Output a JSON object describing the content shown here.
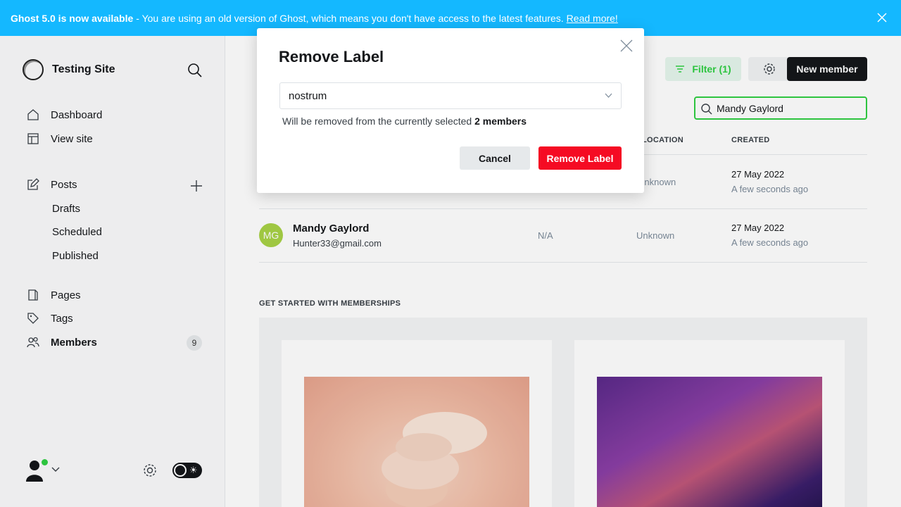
{
  "banner": {
    "title": "Ghost 5.0 is now available",
    "message": "- You are using an old version of Ghost, which means you don't have access to the latest features.",
    "link": "Read more!",
    "color": "#14b8ff"
  },
  "sidebar": {
    "site_title": "Testing Site",
    "nav": {
      "dashboard": "Dashboard",
      "view_site": "View site",
      "posts": "Posts",
      "drafts": "Drafts",
      "scheduled": "Scheduled",
      "published": "Published",
      "pages": "Pages",
      "tags": "Tags",
      "members": "Members",
      "members_count": "9"
    }
  },
  "toolbar": {
    "filter_label": "Filter (1)",
    "new_member_label": "New member",
    "search_value": "Mandy Gaylord"
  },
  "table": {
    "headers": {
      "location": "LOCATION",
      "created": "CREATED"
    },
    "rows": [
      {
        "location": "Unknown",
        "created_date": "27 May 2022",
        "created_rel": "A few seconds ago"
      },
      {
        "initials": "MG",
        "name": "Mandy Gaylord",
        "email": "Hunter33@gmail.com",
        "col_na": "N/A",
        "location": "Unknown",
        "created_date": "27 May 2022",
        "created_rel": "A few seconds ago"
      }
    ]
  },
  "memberships": {
    "section_title": "GET STARTED WITH MEMBERSHIPS"
  },
  "modal": {
    "title": "Remove Label",
    "selected_label": "nostrum",
    "help_prefix": "Will be removed from the currently selected",
    "help_count": "2 members",
    "cancel_label": "Cancel",
    "remove_label": "Remove Label",
    "danger_color": "#f50b23"
  }
}
